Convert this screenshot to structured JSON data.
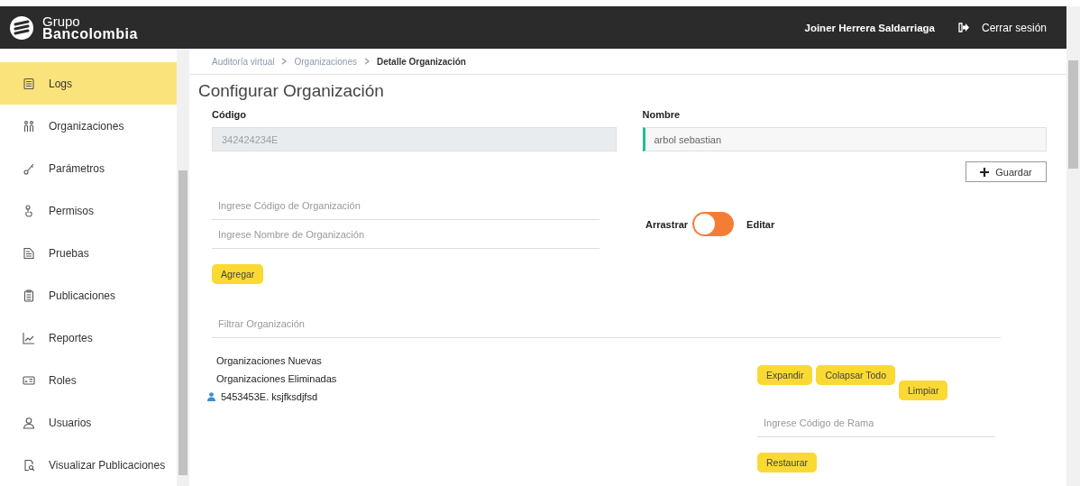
{
  "header": {
    "brand_line1": "Grupo",
    "brand_line2": "Bancolombia",
    "user_name": "Joiner Herrera Saldarriaga",
    "logout": "Cerrar sesión"
  },
  "sidebar": {
    "items": [
      {
        "label": "Logs",
        "selected": true
      },
      {
        "label": "Organizaciones",
        "selected": false
      },
      {
        "label": "Parámetros",
        "selected": false
      },
      {
        "label": "Permisos",
        "selected": false
      },
      {
        "label": "Pruebas",
        "selected": false
      },
      {
        "label": "Publicaciones",
        "selected": false
      },
      {
        "label": "Reportes",
        "selected": false
      },
      {
        "label": "Roles",
        "selected": false
      },
      {
        "label": "Usuarios",
        "selected": false
      },
      {
        "label": "Visualizar Publicaciones",
        "selected": false
      }
    ]
  },
  "breadcrumb": [
    {
      "label": "Auditoría virtual",
      "current": false
    },
    {
      "label": "Organizaciones",
      "current": false
    },
    {
      "label": "Detalle Organización",
      "current": true
    }
  ],
  "title": "Configurar Organización",
  "codigo": {
    "label": "Código",
    "value": "342424234E",
    "disabled": true
  },
  "nombre": {
    "label": "Nombre",
    "value": "arbol sebastian",
    "disabled": false
  },
  "save_button": "Guardar",
  "new_code_field": {
    "placeholder": "Ingrese Código de Organización"
  },
  "new_name_field": {
    "placeholder": "Ingrese Nombre de Organización"
  },
  "mode_switch": {
    "left_label": "Arrastrar",
    "right_label": "Editar",
    "on": false
  },
  "add_button": "Agregar",
  "filter_field": {
    "placeholder": "Filtrar Organización"
  },
  "tree": [
    {
      "label": "Organizaciones Nuevas",
      "kind": "group"
    },
    {
      "label": "Organizaciones Eliminadas",
      "kind": "group"
    },
    {
      "label": "5453453E. ksjfksdjfsd",
      "kind": "user"
    }
  ],
  "tree_buttons": [
    "Expandir",
    "Colapsar Todo",
    "Limpiar"
  ],
  "branch_field": {
    "placeholder": "Ingrese Código de Rama"
  },
  "restore_button": "Restaurar"
}
